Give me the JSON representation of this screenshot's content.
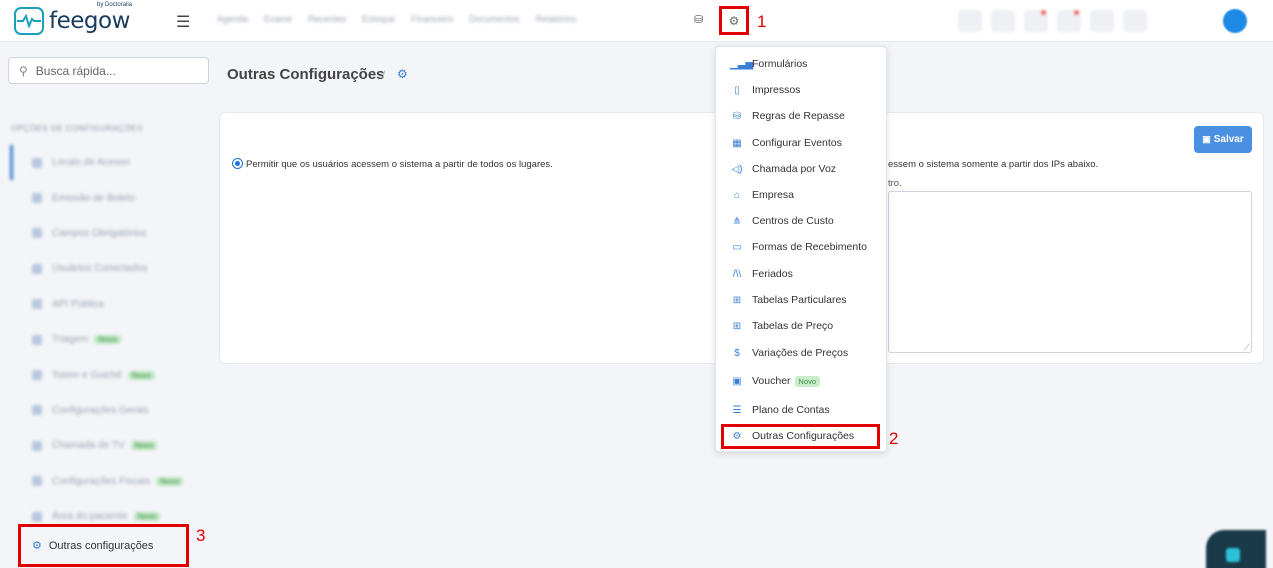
{
  "brand": {
    "name": "feegow",
    "by": "by Doctoralia"
  },
  "topnav": {
    "items": [
      "Agenda",
      "Exame",
      "Recentes",
      "Estoque",
      "Financeiro",
      "Documentos",
      "Relatórios"
    ],
    "annotation_1": "1"
  },
  "search": {
    "placeholder": "Busca rápida..."
  },
  "sidebar": {
    "heading": "OPÇÕES DE CONFIGURAÇÕES",
    "items": [
      {
        "label": "Locais de Acesso",
        "badge": ""
      },
      {
        "label": "Emissão de Boleto",
        "badge": ""
      },
      {
        "label": "Campos Obrigatórios",
        "badge": ""
      },
      {
        "label": "Usuários Conectados",
        "badge": ""
      },
      {
        "label": "API Pública",
        "badge": ""
      },
      {
        "label": "Triagem",
        "badge": "Novo"
      },
      {
        "label": "Totem e Guichê",
        "badge": "Novo"
      },
      {
        "label": "Configurações Gerais",
        "badge": ""
      },
      {
        "label": "Chamada de TV",
        "badge": "Novo"
      },
      {
        "label": "Configurações Fiscais",
        "badge": "Novo"
      },
      {
        "label": "Área do paciente",
        "badge": "Novo"
      }
    ],
    "outras_label": "Outras configurações",
    "annotation_3": "3"
  },
  "page": {
    "title": "Outras Configurações",
    "separator": "/",
    "option_all": "Permitir que os usuários acessem o sistema a partir de todos os lugares.",
    "option_ips": "essem o sistema somente a partir dos IPs abaixo.",
    "option_ips_hint": "tro.",
    "save_label": "Salvar"
  },
  "dropdown": {
    "items": [
      {
        "label": "Formulários",
        "icon": "chart-icon",
        "glyph": "▁▃▅",
        "badge": ""
      },
      {
        "label": "Impressos",
        "icon": "file-icon",
        "glyph": "▯",
        "badge": ""
      },
      {
        "label": "Regras de Repasse",
        "icon": "hand-money-icon",
        "glyph": "⛁",
        "badge": ""
      },
      {
        "label": "Configurar Eventos",
        "icon": "calendar-icon",
        "glyph": "▦",
        "badge": ""
      },
      {
        "label": "Chamada por Voz",
        "icon": "speaker-icon",
        "glyph": "◁)",
        "badge": ""
      },
      {
        "label": "Empresa",
        "icon": "bank-icon",
        "glyph": "⌂",
        "badge": ""
      },
      {
        "label": "Centros de Custo",
        "icon": "sitemap-icon",
        "glyph": "⋔",
        "badge": ""
      },
      {
        "label": "Formas de Recebimento",
        "icon": "credit-card-icon",
        "glyph": "▭",
        "badge": ""
      },
      {
        "label": "Feriados",
        "icon": "road-icon",
        "glyph": "/\\\\",
        "badge": ""
      },
      {
        "label": "Tabelas Particulares",
        "icon": "table-icon",
        "glyph": "⊞",
        "badge": ""
      },
      {
        "label": "Tabelas de Preço",
        "icon": "table-icon",
        "glyph": "⊞",
        "badge": ""
      },
      {
        "label": "Variações de Preços",
        "icon": "dollar-icon",
        "glyph": "$",
        "badge": ""
      },
      {
        "label": "Voucher",
        "icon": "ticket-icon",
        "glyph": "▣",
        "badge": "Novo"
      },
      {
        "label": "Plano de Contas",
        "icon": "list-icon",
        "glyph": "☰",
        "badge": ""
      },
      {
        "label": "Outras Configurações",
        "icon": "cogs-icon",
        "glyph": "⚙",
        "badge": ""
      }
    ],
    "annotation_2": "2"
  },
  "colors": {
    "accent": "#4a90e2",
    "annotation": "#e00000",
    "brand": "#1aa0b8"
  }
}
